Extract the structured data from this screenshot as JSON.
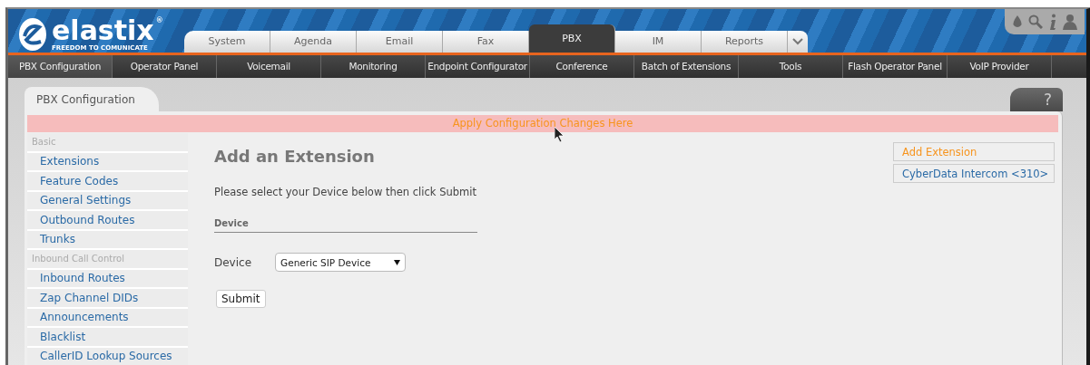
{
  "logo": {
    "name": "elastix",
    "mark": "®",
    "tagline": "FREEDOM TO COMUNICATE"
  },
  "tabs": [
    {
      "label": "System",
      "selected": false
    },
    {
      "label": "Agenda",
      "selected": false
    },
    {
      "label": "Email",
      "selected": false
    },
    {
      "label": "Fax",
      "selected": false
    },
    {
      "label": "PBX",
      "selected": true
    },
    {
      "label": "IM",
      "selected": false
    },
    {
      "label": "Reports",
      "selected": false
    }
  ],
  "subnav": [
    {
      "label": "PBX Configuration",
      "selected": true
    },
    {
      "label": "Operator Panel",
      "selected": false
    },
    {
      "label": "Voicemail",
      "selected": false
    },
    {
      "label": "Monitoring",
      "selected": false
    },
    {
      "label": "Endpoint Configurator",
      "selected": false
    },
    {
      "label": "Conference",
      "selected": false
    },
    {
      "label": "Batch of Extensions",
      "selected": false
    },
    {
      "label": "Tools",
      "selected": false
    },
    {
      "label": "Flash Operator Panel",
      "selected": false
    },
    {
      "label": "VoIP Provider",
      "selected": false
    }
  ],
  "page_tab": "PBX Configuration",
  "help": "?",
  "apply_bar": "Apply Configuration Changes Here",
  "sidebar": [
    {
      "kind": "header",
      "label": "Basic"
    },
    {
      "kind": "link",
      "label": "Extensions"
    },
    {
      "kind": "link",
      "label": "Feature Codes"
    },
    {
      "kind": "link",
      "label": "General Settings"
    },
    {
      "kind": "link",
      "label": "Outbound Routes"
    },
    {
      "kind": "link",
      "label": "Trunks"
    },
    {
      "kind": "header",
      "label": "Inbound Call Control"
    },
    {
      "kind": "link",
      "label": "Inbound Routes"
    },
    {
      "kind": "link",
      "label": "Zap Channel DIDs"
    },
    {
      "kind": "link",
      "label": "Announcements"
    },
    {
      "kind": "link",
      "label": "Blacklist"
    },
    {
      "kind": "link",
      "label": "CallerID Lookup Sources"
    }
  ],
  "form": {
    "title": "Add an Extension",
    "intro": "Please select your Device below then click Submit",
    "section": "Device",
    "field_label": "Device",
    "device": "Generic SIP Device",
    "submit": "Submit"
  },
  "right_list": [
    {
      "label": "Add Extension",
      "selected": true
    },
    {
      "label": "CyberData Intercom <310>",
      "selected": false
    }
  ]
}
